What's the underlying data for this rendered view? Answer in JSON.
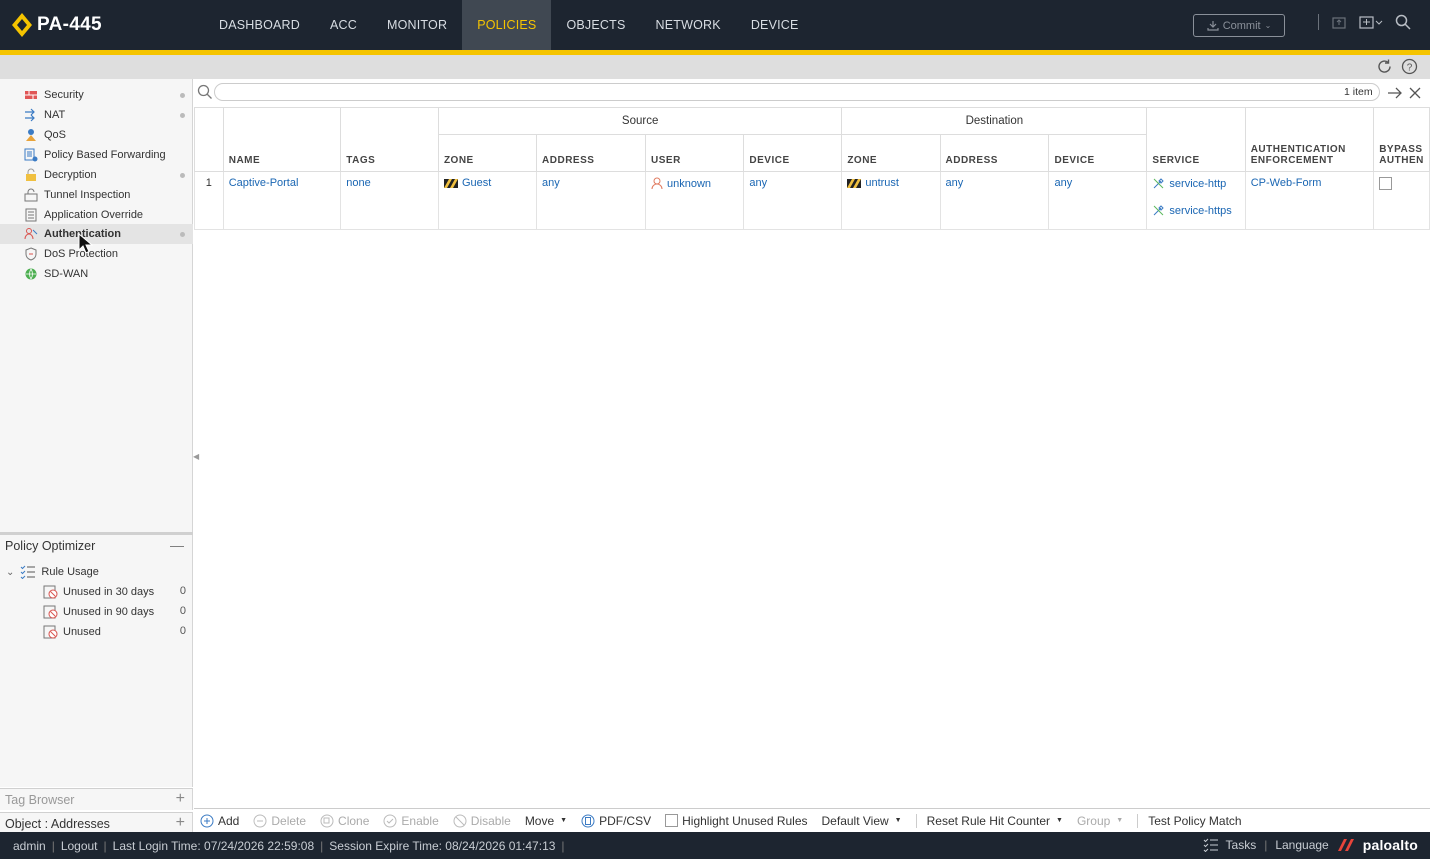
{
  "app": {
    "title": "PA-445",
    "nav_tabs": [
      {
        "label": "DASHBOARD"
      },
      {
        "label": "ACC"
      },
      {
        "label": "MONITOR"
      },
      {
        "label": "POLICIES",
        "active": true
      },
      {
        "label": "OBJECTS"
      },
      {
        "label": "NETWORK"
      },
      {
        "label": "DEVICE"
      }
    ],
    "commit_label": "Commit",
    "accent_color": "#f5c400",
    "topbar_color": "#1d2530"
  },
  "sidebar": {
    "items": [
      {
        "label": "Security",
        "icon": "security-icon"
      },
      {
        "label": "NAT",
        "icon": "nat-icon"
      },
      {
        "label": "QoS",
        "icon": "qos-icon"
      },
      {
        "label": "Policy Based Forwarding",
        "icon": "pbf-icon"
      },
      {
        "label": "Decryption",
        "icon": "decryption-icon"
      },
      {
        "label": "Tunnel Inspection",
        "icon": "tunnel-icon"
      },
      {
        "label": "Application Override",
        "icon": "app-override-icon"
      },
      {
        "label": "Authentication",
        "icon": "authentication-icon",
        "active": true
      },
      {
        "label": "DoS Protection",
        "icon": "dos-icon"
      },
      {
        "label": "SD-WAN",
        "icon": "sdwan-icon"
      }
    ]
  },
  "optimizer": {
    "title": "Policy Optimizer",
    "rule_usage_label": "Rule Usage",
    "items": [
      {
        "label": "Unused in 30 days",
        "count": "0"
      },
      {
        "label": "Unused in 90 days",
        "count": "0"
      },
      {
        "label": "Unused",
        "count": "0"
      }
    ]
  },
  "tag_browser_label": "Tag Browser",
  "object_addresses_label": "Object : Addresses",
  "search": {
    "item_count": "1 item"
  },
  "table": {
    "group_source": "Source",
    "group_destination": "Destination",
    "headers": {
      "name": "NAME",
      "tags": "TAGS",
      "src_zone": "ZONE",
      "src_address": "ADDRESS",
      "src_user": "USER",
      "src_device": "DEVICE",
      "dst_zone": "ZONE",
      "dst_address": "ADDRESS",
      "dst_device": "DEVICE",
      "service": "SERVICE",
      "auth_enforcement_1": "AUTHENTICATION",
      "auth_enforcement_2": "ENFORCEMENT",
      "bypass_1": "BYPASS",
      "bypass_2": "AUTHEN"
    },
    "rows": [
      {
        "num": "1",
        "name": "Captive-Portal",
        "tags": "none",
        "src_zone": "Guest",
        "src_address": "any",
        "src_user": "unknown",
        "src_device": "any",
        "dst_zone": "untrust",
        "dst_address": "any",
        "dst_device": "any",
        "services": [
          "service-http",
          "service-https"
        ],
        "auth_enforcement": "CP-Web-Form"
      }
    ]
  },
  "toolbar": {
    "add": "Add",
    "delete": "Delete",
    "clone": "Clone",
    "enable": "Enable",
    "disable": "Disable",
    "move": "Move",
    "pdf_csv": "PDF/CSV",
    "highlight_unused": "Highlight Unused Rules",
    "default_view": "Default View",
    "reset_counter": "Reset Rule Hit Counter",
    "group": "Group",
    "test_policy": "Test Policy Match"
  },
  "status": {
    "user": "admin",
    "logout": "Logout",
    "last_login": "Last Login Time: 07/24/2026 22:59:08",
    "session_expire": "Session Expire Time: 08/24/2026 01:47:13",
    "tasks": "Tasks",
    "language": "Language",
    "brand": "paloalto"
  }
}
